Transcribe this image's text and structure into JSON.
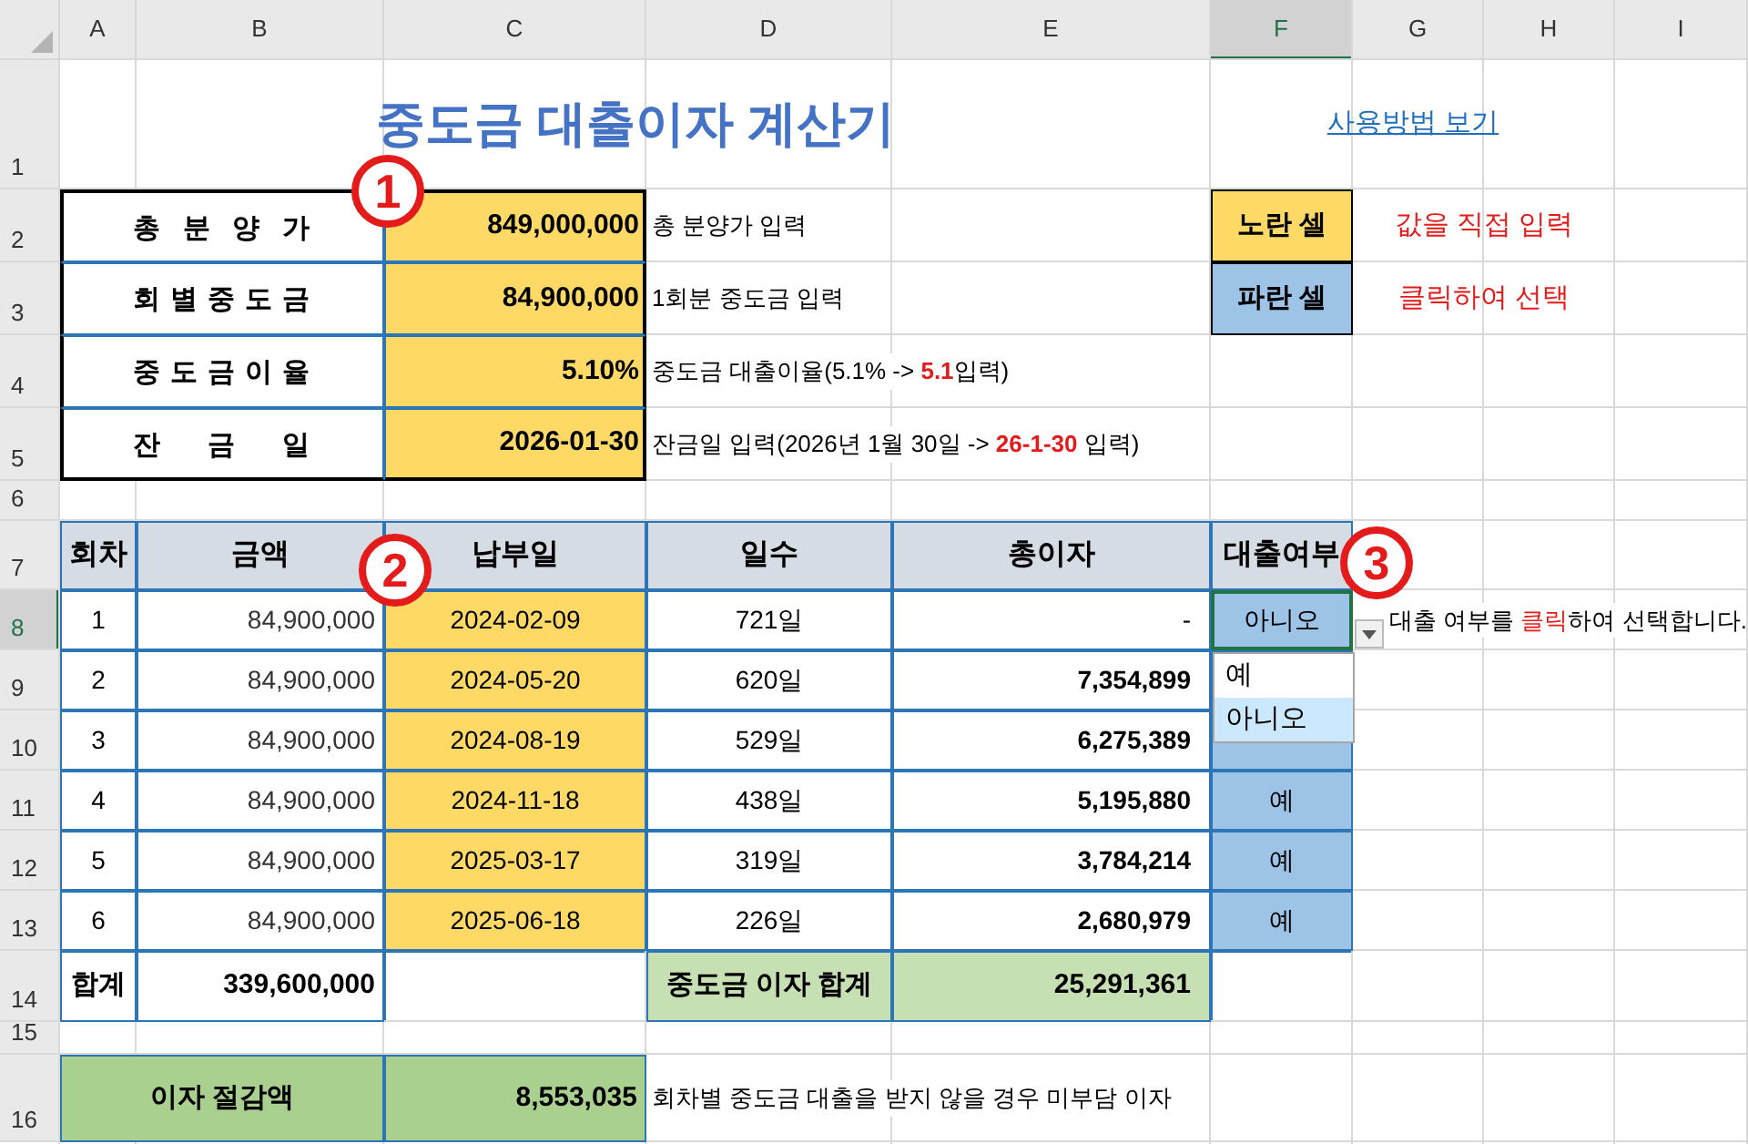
{
  "column_headers": [
    {
      "label": "A",
      "selected": false
    },
    {
      "label": "B",
      "selected": false
    },
    {
      "label": "C",
      "selected": false
    },
    {
      "label": "D",
      "selected": false
    },
    {
      "label": "E",
      "selected": false
    },
    {
      "label": "F",
      "selected": true
    },
    {
      "label": "G",
      "selected": false
    },
    {
      "label": "H",
      "selected": false
    },
    {
      "label": "I",
      "selected": false
    }
  ],
  "row_numbers": [
    {
      "label": "1",
      "selected": false
    },
    {
      "label": "2",
      "selected": false
    },
    {
      "label": "3",
      "selected": false
    },
    {
      "label": "4",
      "selected": false
    },
    {
      "label": "5",
      "selected": false
    },
    {
      "label": "6",
      "selected": false
    },
    {
      "label": "7",
      "selected": false
    },
    {
      "label": "8",
      "selected": true
    },
    {
      "label": "9",
      "selected": false
    },
    {
      "label": "10",
      "selected": false
    },
    {
      "label": "11",
      "selected": false
    },
    {
      "label": "12",
      "selected": false
    },
    {
      "label": "13",
      "selected": false
    },
    {
      "label": "14",
      "selected": false
    },
    {
      "label": "15",
      "selected": false
    },
    {
      "label": "16",
      "selected": false
    }
  ],
  "title": "중도금 대출이자 계산기",
  "help_link": "사용방법 보기",
  "inputs": [
    {
      "label": "총 분 양 가",
      "value": "849,000,000",
      "note": "총 분양가 입력"
    },
    {
      "label": "회 별 중 도 금",
      "value": "84,900,000",
      "note": "1회분 중도금 입력"
    },
    {
      "label": "중 도 금 이 율",
      "value": "5.10%",
      "note": "중도금 대출이율(5.1%  -> **5.1**입력)"
    },
    {
      "label": "잔 금 일",
      "value": "2026-01-30",
      "note": "잔금일 입력(2026년 1월 30일 -> **26-1-30** 입력)"
    }
  ],
  "legend": [
    {
      "label": "노란 셀",
      "color": "#ffd966",
      "description": "값을 직접 입력"
    },
    {
      "label": "파란 셀",
      "color": "#9dc3e6",
      "description": "클릭하여 선택"
    }
  ],
  "markers": [
    "1",
    "2",
    "3"
  ],
  "table": {
    "columns": [
      "회차",
      "금액",
      "납부일",
      "일수",
      "총이자",
      "대출여부"
    ],
    "rows": [
      {
        "no": "1",
        "amount": "84,900,000",
        "date": "2024-02-09",
        "days": "721일",
        "interest": "-",
        "loan": "아니오",
        "selected": true
      },
      {
        "no": "2",
        "amount": "84,900,000",
        "date": "2024-05-20",
        "days": "620일",
        "interest": "7,354,899",
        "selected": false
      },
      {
        "no": "3",
        "amount": "84,900,000",
        "date": "2024-08-19",
        "days": "529일",
        "interest": "6,275,389",
        "selected": false
      },
      {
        "no": "4",
        "amount": "84,900,000",
        "date": "2024-11-18",
        "days": "438일",
        "interest": "5,195,880",
        "loan": "예",
        "selected": false
      },
      {
        "no": "5",
        "amount": "84,900,000",
        "date": "2025-03-17",
        "days": "319일",
        "interest": "3,784,214",
        "loan": "예",
        "selected": false
      },
      {
        "no": "6",
        "amount": "84,900,000",
        "date": "2025-06-18",
        "days": "226일",
        "interest": "2,680,979",
        "loan": "예",
        "selected": false
      }
    ],
    "total_label": "합계",
    "total_amount": "339,600,000",
    "interest_total_label": "중도금 이자 합계",
    "interest_total": "25,291,361",
    "loan_note": "대출 여부를 **클릭**하여 선택합니다."
  },
  "dropdown": {
    "options": [
      {
        "label": "예",
        "selected": false
      },
      {
        "label": "아니오",
        "selected": true
      }
    ]
  },
  "savings": {
    "label": "이자 절감액",
    "value": "8,553,035",
    "note": "회차별 중도금 대출을 받지 않을 경우 미부담 이자"
  }
}
